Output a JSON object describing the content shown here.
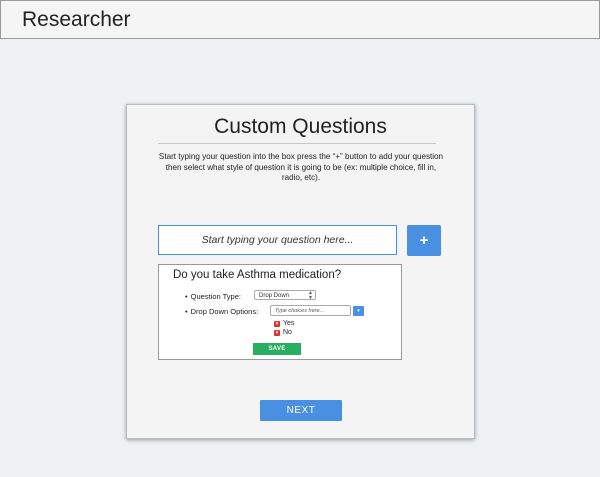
{
  "header": {
    "title": "Researcher"
  },
  "card": {
    "title": "Custom Questions",
    "description": "Start typing your question into the box press the “+” button to add your question then select what style of question it is going to be (ex: multiple choice, fill in, radio, etc).",
    "question_input": {
      "placeholder": "Start typing your question here...",
      "value": ""
    },
    "add_button_label": "+",
    "question": {
      "text": "Do you take Asthma medication?",
      "type_label": "Question Type:",
      "type_value": "Drop Down",
      "options_label": "Drop Down Options:",
      "choice_input_placeholder": "Type choices here...",
      "choice_add_label": "▾",
      "choices": [
        {
          "label": "Yes"
        },
        {
          "label": "No"
        }
      ],
      "save_label": "SAVE"
    },
    "next_label": "NEXT"
  }
}
